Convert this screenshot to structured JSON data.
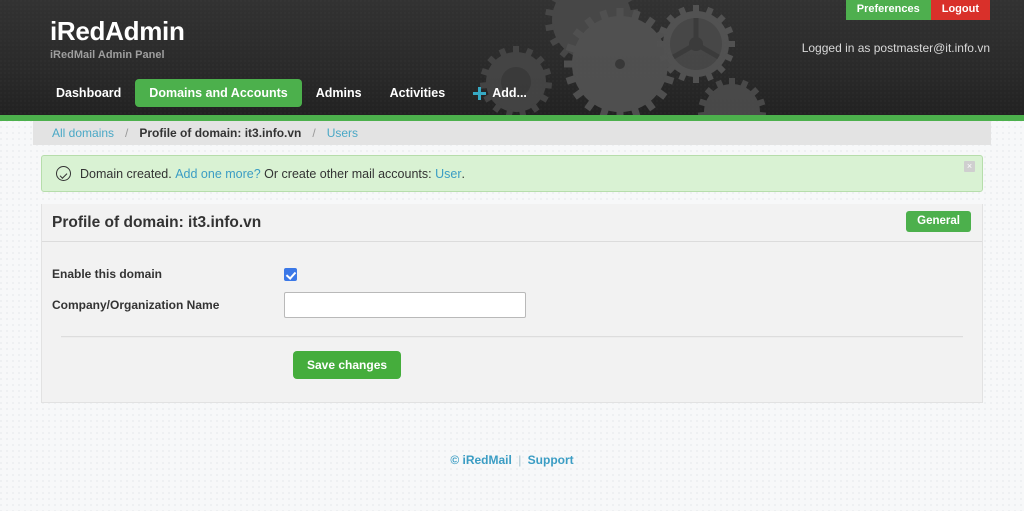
{
  "header": {
    "brand_title": "iRedAdmin",
    "brand_subtitle": "iRedMail Admin Panel",
    "preferences_label": "Preferences",
    "logout_label": "Logout",
    "logged_in_text": "Logged in as postmaster@it.info.vn",
    "accent_green": "#4cb04c",
    "logout_red": "#d9302a",
    "plus_cyan": "#36a9c4"
  },
  "nav": {
    "items": [
      {
        "label": "Dashboard",
        "active": false,
        "icon": ""
      },
      {
        "label": "Domains and Accounts",
        "active": true,
        "icon": ""
      },
      {
        "label": "Admins",
        "active": false,
        "icon": ""
      },
      {
        "label": "Activities",
        "active": false,
        "icon": ""
      },
      {
        "label": "Add...",
        "active": false,
        "icon": "plus-icon"
      }
    ]
  },
  "breadcrumb": {
    "all_domains": "All domains",
    "sep1": "/",
    "profile": "Profile of domain: it3.info.vn",
    "sep2": "/",
    "users": "Users"
  },
  "alert": {
    "icon": "check-circle-icon",
    "text_1": "Domain created.",
    "link_add_more": "Add one more?",
    "text_2": "Or create other mail accounts:",
    "link_user": "User",
    "text_3": ".",
    "close_label": "×",
    "background": "#d9f2d3",
    "border": "#b6ddab"
  },
  "panel": {
    "title": "Profile of domain: it3.info.vn",
    "tab_general": "General",
    "fields": [
      {
        "label": "Enable this domain",
        "type": "checkbox",
        "checked": true
      },
      {
        "label": "Company/Organization Name",
        "type": "text",
        "value": "",
        "placeholder": ""
      }
    ],
    "save_label": "Save changes"
  },
  "footer": {
    "copyright": "© iRedMail",
    "separator": "|",
    "support": "Support"
  }
}
